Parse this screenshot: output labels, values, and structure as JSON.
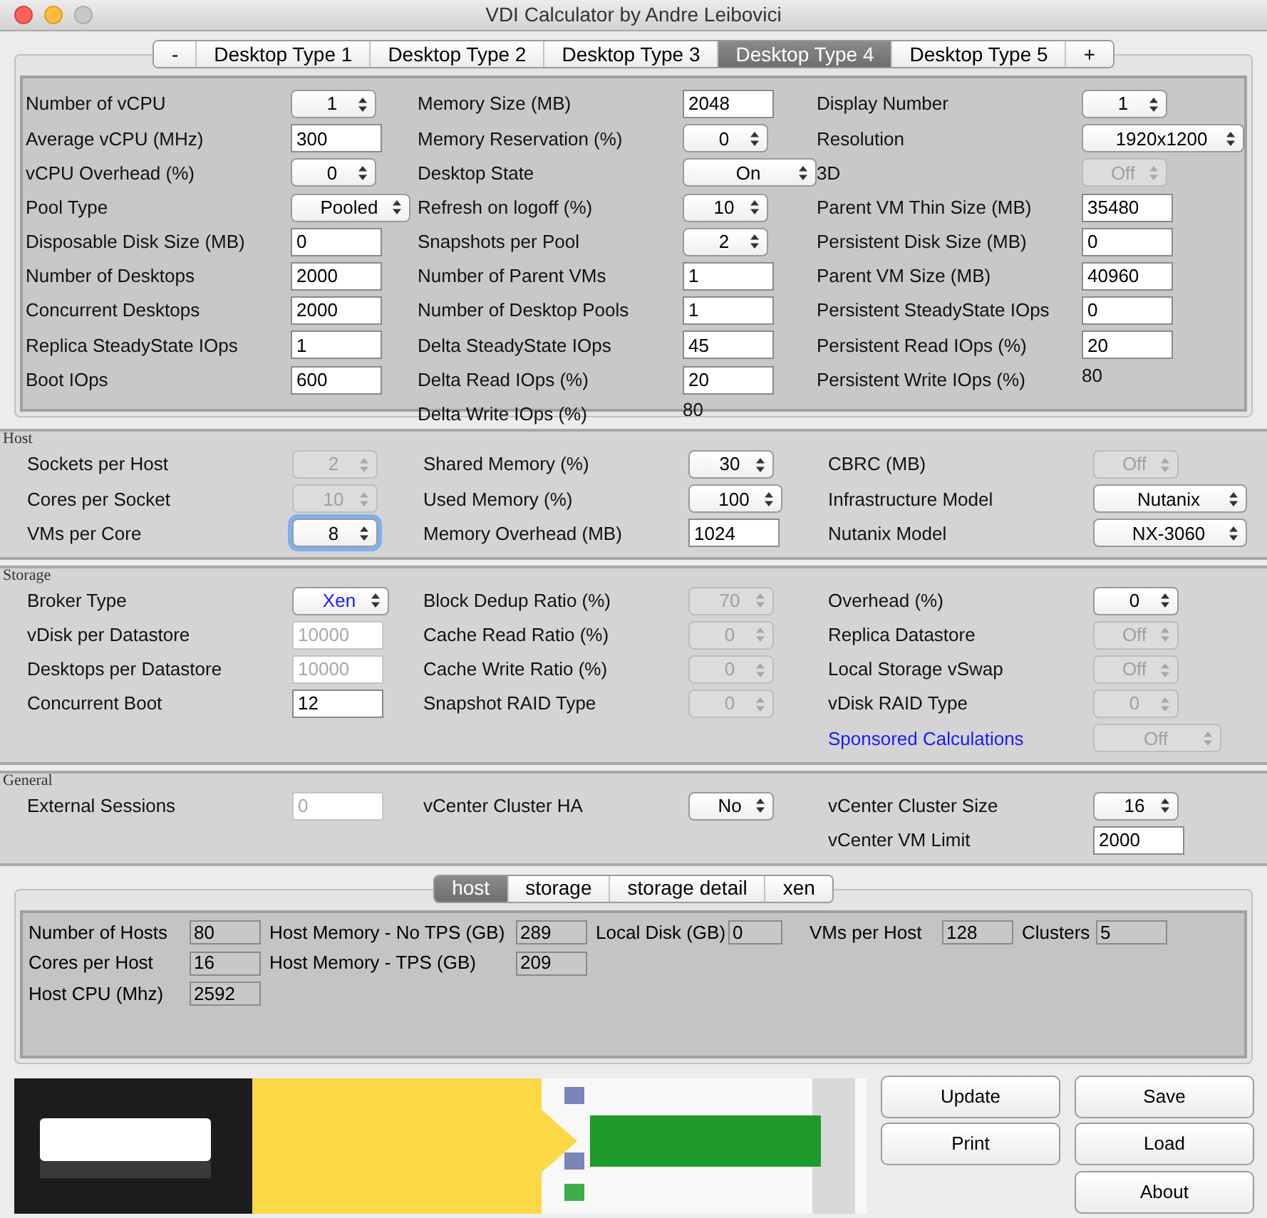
{
  "window": {
    "title": "VDI Calculator by Andre Leibovici"
  },
  "desktop_tabs": [
    {
      "label": "-",
      "selected": false
    },
    {
      "label": "Desktop Type 1",
      "selected": false
    },
    {
      "label": "Desktop Type 2",
      "selected": false
    },
    {
      "label": "Desktop Type 3",
      "selected": false
    },
    {
      "label": "Desktop Type 4",
      "selected": true
    },
    {
      "label": "Desktop Type 5",
      "selected": false
    },
    {
      "label": "+",
      "selected": false
    }
  ],
  "desktop_panel": {
    "columns": [
      [
        {
          "label": "Number of vCPU",
          "kind": "spinner",
          "value": "1",
          "disabled": false
        },
        {
          "label": "Average vCPU (MHz)",
          "kind": "input",
          "value": "300",
          "disabled": false
        },
        {
          "label": "vCPU Overhead (%)",
          "kind": "spinner",
          "value": "0",
          "disabled": false
        },
        {
          "label": "Pool Type",
          "kind": "spinner",
          "value": "Pooled",
          "disabled": false
        },
        {
          "label": "Disposable Disk Size (MB)",
          "kind": "input",
          "value": "0",
          "disabled": false
        },
        {
          "label": "Number of Desktops",
          "kind": "input",
          "value": "2000",
          "disabled": false
        },
        {
          "label": "Concurrent Desktops",
          "kind": "input",
          "value": "2000",
          "disabled": false
        },
        {
          "label": "Replica SteadyState IOps",
          "kind": "input",
          "value": "1",
          "disabled": false
        },
        {
          "label": "Boot IOps",
          "kind": "input",
          "value": "600",
          "disabled": false
        }
      ],
      [
        {
          "label": "Memory Size (MB)",
          "kind": "input",
          "value": "2048",
          "disabled": false
        },
        {
          "label": "Memory Reservation (%)",
          "kind": "spinner",
          "value": "0",
          "disabled": false
        },
        {
          "label": "Desktop State",
          "kind": "spinner",
          "value": "On",
          "disabled": false
        },
        {
          "label": "Refresh on logoff (%)",
          "kind": "spinner",
          "value": "10",
          "disabled": false
        },
        {
          "label": "Snapshots per Pool",
          "kind": "spinner",
          "value": "2",
          "disabled": false
        },
        {
          "label": "Number of Parent VMs",
          "kind": "input",
          "value": "1",
          "disabled": false
        },
        {
          "label": "Number of Desktop Pools",
          "kind": "input",
          "value": "1",
          "disabled": false
        },
        {
          "label": "Delta SteadyState IOps",
          "kind": "input",
          "value": "45",
          "disabled": false
        },
        {
          "label": "Delta Read IOps (%)",
          "kind": "input",
          "value": "20",
          "disabled": false
        },
        {
          "label": "Delta Write IOps (%)",
          "kind": "text",
          "value": "80"
        }
      ],
      [
        {
          "label": "Display Number",
          "kind": "spinner",
          "value": "1",
          "disabled": false
        },
        {
          "label": "Resolution",
          "kind": "spinner",
          "value": "1920x1200",
          "disabled": false
        },
        {
          "label": "3D",
          "kind": "spinner",
          "value": "Off",
          "disabled": true
        },
        {
          "label": "Parent VM Thin Size (MB)",
          "kind": "input",
          "value": "35480",
          "disabled": false
        },
        {
          "label": "Persistent Disk Size (MB)",
          "kind": "input",
          "value": "0",
          "disabled": false
        },
        {
          "label": "Parent VM Size (MB)",
          "kind": "input",
          "value": "40960",
          "disabled": false
        },
        {
          "label": "Persistent SteadyState IOps",
          "kind": "input",
          "value": "0",
          "disabled": false
        },
        {
          "label": "Persistent Read IOps (%)",
          "kind": "input",
          "value": "20",
          "disabled": false
        },
        {
          "label": "Persistent Write IOps (%)",
          "kind": "text",
          "value": "80"
        }
      ]
    ]
  },
  "sections": [
    {
      "title": "Host",
      "columns": [
        [
          {
            "label": "Sockets per Host",
            "kind": "spinner",
            "value": "2",
            "disabled": true
          },
          {
            "label": "Cores per Socket",
            "kind": "spinner",
            "value": "10",
            "disabled": true
          },
          {
            "label": "VMs per Core",
            "kind": "spinner",
            "value": "8",
            "disabled": false,
            "focused": true
          }
        ],
        [
          {
            "label": "Shared Memory (%)",
            "kind": "spinner",
            "value": "30",
            "disabled": false
          },
          {
            "label": "Used Memory (%)",
            "kind": "spinner",
            "value": "100",
            "disabled": false
          },
          {
            "label": "Memory Overhead (MB)",
            "kind": "input",
            "value": "1024",
            "disabled": false
          }
        ],
        [
          {
            "label": "CBRC (MB)",
            "kind": "spinner",
            "value": "Off",
            "disabled": true
          },
          {
            "label": "Infrastructure Model",
            "kind": "spinner",
            "value": "Nutanix",
            "disabled": false
          },
          {
            "label": "Nutanix Model",
            "kind": "spinner",
            "value": "NX-3060",
            "disabled": false
          }
        ]
      ]
    },
    {
      "title": "Storage",
      "columns": [
        [
          {
            "label": "Broker Type",
            "kind": "spinner",
            "value": "Xen",
            "disabled": false,
            "highlighted": true
          },
          {
            "label": "vDisk per Datastore",
            "kind": "input",
            "value": "10000",
            "disabled": true
          },
          {
            "label": "Desktops per Datastore",
            "kind": "input",
            "value": "10000",
            "disabled": true
          },
          {
            "label": "Concurrent Boot",
            "kind": "input",
            "value": "12",
            "disabled": false
          }
        ],
        [
          {
            "label": "Block Dedup Ratio (%)",
            "kind": "spinner",
            "value": "70",
            "disabled": true
          },
          {
            "label": "Cache Read Ratio (%)",
            "kind": "spinner",
            "value": "0",
            "disabled": true
          },
          {
            "label": "Cache Write Ratio (%)",
            "kind": "spinner",
            "value": "0",
            "disabled": true
          },
          {
            "label": "Snapshot RAID Type",
            "kind": "spinner",
            "value": "0",
            "disabled": true
          }
        ],
        [
          {
            "label": "Overhead (%)",
            "kind": "spinner",
            "value": "0",
            "disabled": false
          },
          {
            "label": "Replica Datastore",
            "kind": "spinner",
            "value": "Off",
            "disabled": true
          },
          {
            "label": "Local Storage vSwap",
            "kind": "spinner",
            "value": "Off",
            "disabled": true
          },
          {
            "label": "vDisk RAID Type",
            "kind": "spinner",
            "value": "0",
            "disabled": true
          },
          {
            "label": "Sponsored Calculations",
            "is_link": true,
            "kind": "spinner",
            "value": "Off",
            "disabled": true
          }
        ]
      ]
    },
    {
      "title": "General",
      "columns": [
        [
          {
            "label": "External Sessions",
            "kind": "input",
            "value": "0",
            "disabled": true
          }
        ],
        [
          {
            "label": "vCenter Cluster HA",
            "kind": "spinner",
            "value": "No",
            "disabled": false
          }
        ],
        [
          {
            "label": "vCenter Cluster Size",
            "kind": "spinner",
            "value": "16",
            "disabled": false
          },
          {
            "label": "vCenter VM Limit",
            "kind": "input",
            "value": "2000",
            "disabled": false
          }
        ]
      ]
    }
  ],
  "result_tabs": [
    {
      "label": "host",
      "selected": true
    },
    {
      "label": "storage",
      "selected": false
    },
    {
      "label": "storage detail",
      "selected": false
    },
    {
      "label": "xen",
      "selected": false
    }
  ],
  "results": {
    "rows": [
      [
        {
          "label": "Number of Hosts",
          "value": "80"
        },
        {
          "label": "Host Memory - No TPS (GB)",
          "value": "289"
        },
        {
          "label": "Local Disk (GB)",
          "value": "0"
        },
        {
          "label": "VMs per Host",
          "value": "128"
        },
        {
          "label": "Clusters",
          "value": "5"
        }
      ],
      [
        {
          "label": "Cores per Host",
          "value": "16"
        },
        {
          "label": "Host Memory - TPS (GB)",
          "value": "209"
        }
      ],
      [
        {
          "label": "Host CPU (Mhz)",
          "value": "2592"
        }
      ]
    ]
  },
  "buttons": [
    "Update",
    "Save",
    "Print",
    "Load",
    "About"
  ]
}
